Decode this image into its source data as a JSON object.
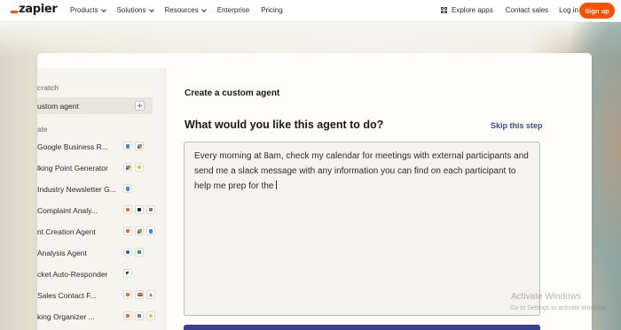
{
  "nav": {
    "logo": "zapier",
    "items": [
      {
        "label": "Products",
        "dropdown": true
      },
      {
        "label": "Solutions",
        "dropdown": true
      },
      {
        "label": "Resources",
        "dropdown": true
      },
      {
        "label": "Enterprise",
        "dropdown": false
      },
      {
        "label": "Pricing",
        "dropdown": false
      }
    ],
    "explore_apps": "Explore apps",
    "contact_sales": "Contact sales",
    "login": "Log in",
    "signup": "Sign up",
    "brand_color": "#ff4f00"
  },
  "sidebar": {
    "scratch_header": "cratch",
    "custom_agent": "ustom agent",
    "template_header": "ate",
    "templates": [
      {
        "label": "Google Business R...",
        "icons": [
          "gdoc",
          "multi"
        ]
      },
      {
        "label": "lking Point Generator",
        "icons": [
          "multi",
          "yellow"
        ]
      },
      {
        "label": "Industry Newsletter G...",
        "icons": [
          "gdoc"
        ]
      },
      {
        "label": "Complaint Analy...",
        "icons": [
          "orange",
          "dark",
          "gmail"
        ]
      },
      {
        "label": "nt Creation Agent",
        "icons": [
          "orange",
          "multi",
          "gdoc"
        ]
      },
      {
        "label": "Analysis Agent",
        "icons": [
          "round",
          "green"
        ]
      },
      {
        "label": "cket Auto-Responder",
        "icons": [
          "zendesk"
        ]
      },
      {
        "label": "Sales Contact F...",
        "icons": [
          "orange",
          "bars",
          "tri"
        ]
      },
      {
        "label": "king Organizer ...",
        "icons": [
          "orange",
          "gmail",
          "yellow"
        ]
      }
    ]
  },
  "main": {
    "title": "Create a custom agent",
    "question": "What would you like this agent to do?",
    "skip": "Skip this step",
    "prompt_value": "Every morning at 8am, check my calendar for meetings with external participants and send me a slack message with any information you can find on each participant to help me prep for the"
  },
  "watermark": {
    "line1": "Activate Windows",
    "line2": "Go to Settings to activate Windows."
  }
}
